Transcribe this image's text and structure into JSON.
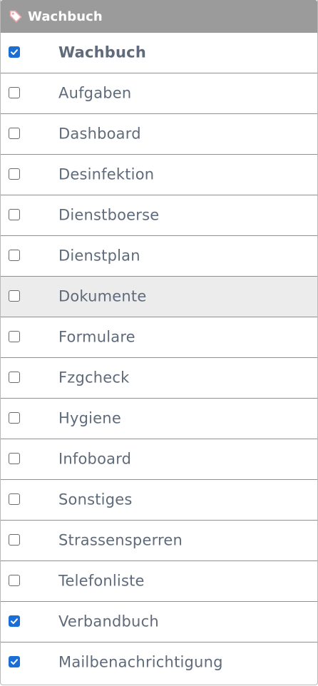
{
  "header": {
    "title": "Wachbuch",
    "icon": "tag-icon"
  },
  "colors": {
    "header_bg": "#9b9b9b",
    "checkbox_checked": "#1a6fd6",
    "label_text": "#5f6b7a",
    "highlight_row": "#ececec"
  },
  "items": [
    {
      "label": "Wachbuch",
      "checked": true,
      "bold": true,
      "highlighted": false
    },
    {
      "label": "Aufgaben",
      "checked": false,
      "bold": false,
      "highlighted": false
    },
    {
      "label": "Dashboard",
      "checked": false,
      "bold": false,
      "highlighted": false
    },
    {
      "label": "Desinfektion",
      "checked": false,
      "bold": false,
      "highlighted": false
    },
    {
      "label": "Dienstboerse",
      "checked": false,
      "bold": false,
      "highlighted": false
    },
    {
      "label": "Dienstplan",
      "checked": false,
      "bold": false,
      "highlighted": false
    },
    {
      "label": "Dokumente",
      "checked": false,
      "bold": false,
      "highlighted": true
    },
    {
      "label": "Formulare",
      "checked": false,
      "bold": false,
      "highlighted": false
    },
    {
      "label": "Fzgcheck",
      "checked": false,
      "bold": false,
      "highlighted": false
    },
    {
      "label": "Hygiene",
      "checked": false,
      "bold": false,
      "highlighted": false
    },
    {
      "label": "Infoboard",
      "checked": false,
      "bold": false,
      "highlighted": false
    },
    {
      "label": "Sonstiges",
      "checked": false,
      "bold": false,
      "highlighted": false
    },
    {
      "label": "Strassensperren",
      "checked": false,
      "bold": false,
      "highlighted": false
    },
    {
      "label": "Telefonliste",
      "checked": false,
      "bold": false,
      "highlighted": false
    },
    {
      "label": "Verbandbuch",
      "checked": true,
      "bold": false,
      "highlighted": false
    },
    {
      "label": "Mailbenachrichtigung",
      "checked": true,
      "bold": false,
      "highlighted": false
    }
  ]
}
